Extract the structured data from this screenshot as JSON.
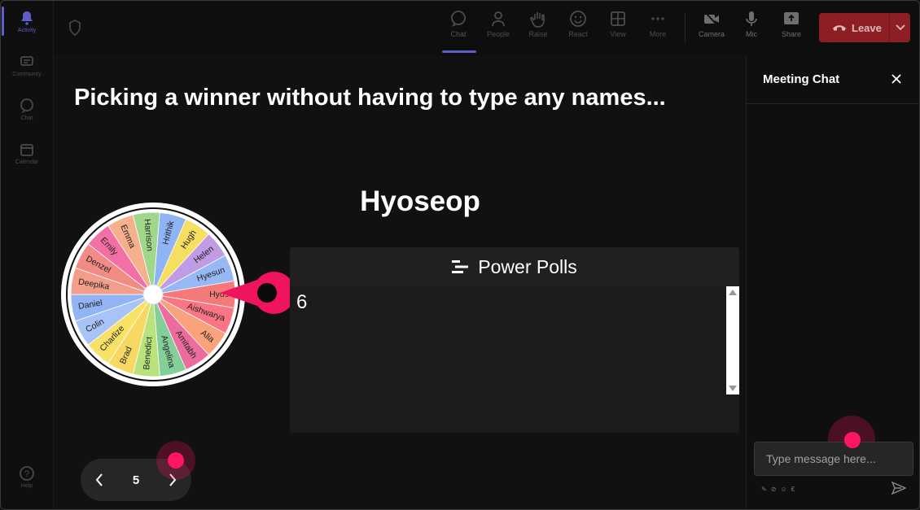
{
  "rail": {
    "items": [
      {
        "label": "Activity",
        "icon": "bell-icon"
      },
      {
        "label": "Community",
        "icon": "community-icon"
      },
      {
        "label": "Chat",
        "icon": "chat-icon"
      },
      {
        "label": "Calendar",
        "icon": "calendar-icon"
      },
      {
        "label": "Help",
        "icon": "help-icon"
      }
    ]
  },
  "toolbar": {
    "buttons": [
      {
        "label": "Chat",
        "icon": "chat-icon"
      },
      {
        "label": "People",
        "icon": "people-icon"
      },
      {
        "label": "Raise",
        "icon": "raise-hand-icon"
      },
      {
        "label": "React",
        "icon": "emoji-icon"
      },
      {
        "label": "View",
        "icon": "grid-icon"
      },
      {
        "label": "More",
        "icon": "more-icon"
      },
      {
        "label": "Camera",
        "icon": "camera-icon"
      },
      {
        "label": "Mic",
        "icon": "mic-icon"
      },
      {
        "label": "Share",
        "icon": "share-icon"
      }
    ],
    "leave_label": "Leave",
    "leave_color": "#8d1f24",
    "accent": "#5b5fc7"
  },
  "stage": {
    "headline": "Picking a winner without having to type any names...",
    "winner": "Hyoseop",
    "wheel": {
      "names": [
        "Hyos",
        "Aishwarya",
        "Alia",
        "Amitabh",
        "Angelina",
        "Benedict",
        "Brad",
        "Charlize",
        "Colin",
        "Daniel",
        "Deepika",
        "Denzel",
        "Emily",
        "Emma",
        "Harrison",
        "Hrithik",
        "Hugh",
        "Helen",
        "Hyesun"
      ],
      "colors": [
        "#f47a7a",
        "#fb7585",
        "#f9a27b",
        "#ec6d9d",
        "#83cf97",
        "#b9e27d",
        "#f6d862",
        "#f8e266",
        "#a7c3f7",
        "#92b4f5",
        "#f59d8b",
        "#f18b85",
        "#f46fa3",
        "#f6b08c",
        "#9fd88a",
        "#8eb4f6",
        "#f6de60",
        "#c09be6",
        "#96b8f5"
      ]
    },
    "poll": {
      "title": "Power Polls",
      "value": "6"
    },
    "pager": {
      "page": "5"
    }
  },
  "chat": {
    "title": "Meeting Chat",
    "input_placeholder": "Type message here..."
  }
}
